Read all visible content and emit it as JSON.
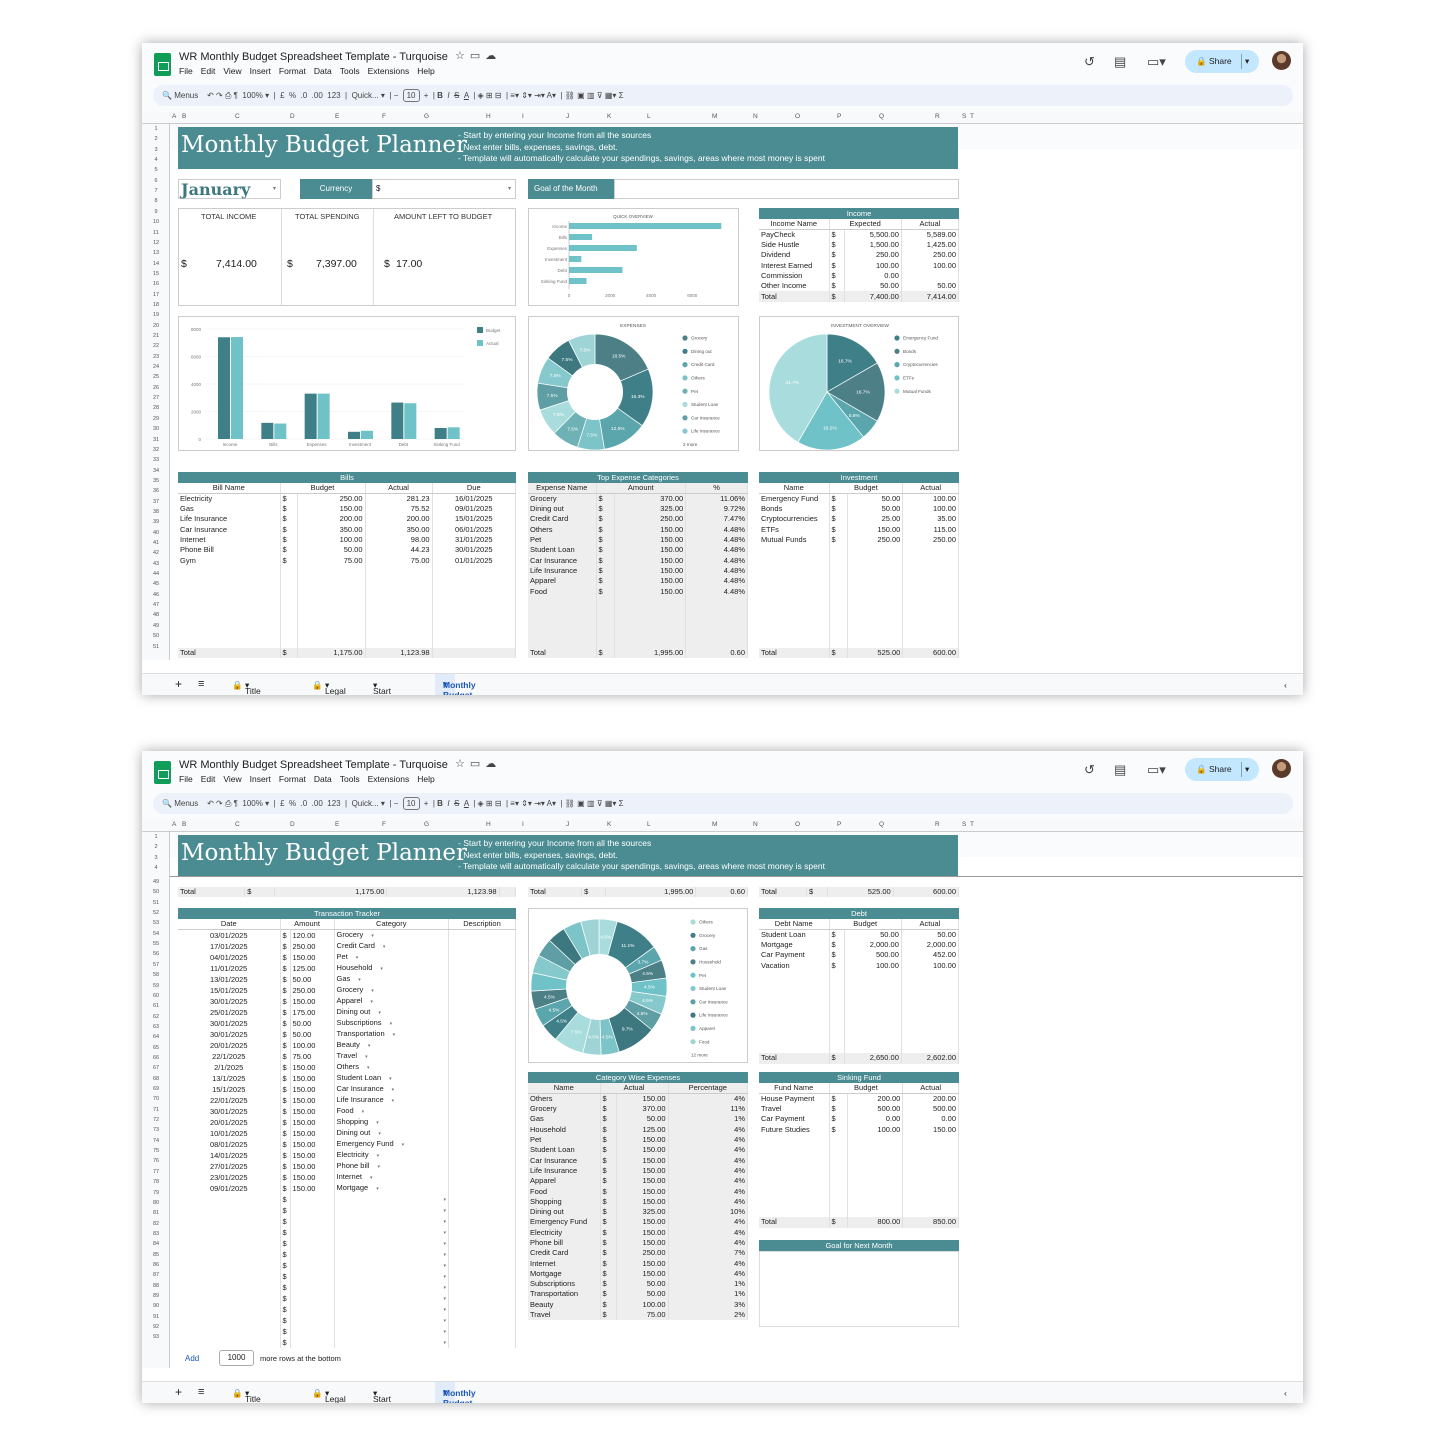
{
  "app": {
    "title": "WR Monthly Budget Spreadsheet Template - Turquoise",
    "menu": [
      "File",
      "Edit",
      "View",
      "Insert",
      "Format",
      "Data",
      "Tools",
      "Extensions",
      "Help"
    ],
    "share": "Share",
    "toolbar": {
      "search": "Menus",
      "zoom": "100%",
      "cur": "£",
      "pct": "%",
      "dec1": ".0",
      "dec2": ".00",
      "num": "123",
      "font": "Quick...",
      "size": "10"
    }
  },
  "colheaders": [
    "A",
    "B",
    "C",
    "D",
    "E",
    "F",
    "G",
    "H",
    "I",
    "J",
    "K",
    "L",
    "M",
    "N",
    "O",
    "P",
    "Q",
    "R",
    "S",
    "T"
  ],
  "tabs": [
    "Title Page",
    "Legal",
    "Start Here",
    "Monthly Budget"
  ],
  "header": {
    "title": "Monthly Budget Planner",
    "notes": [
      "- Start by entering your Income from all the sources",
      "- Next enter bills, expenses, savings, debt.",
      "- Template will automatically calculate your spendings, savings, areas where most money is spent"
    ]
  },
  "month": "January",
  "currency_label": "Currency",
  "currency_value": "$",
  "goal_label": "Goal of the Month",
  "summary": {
    "labels": [
      "TOTAL INCOME",
      "TOTAL SPENDING",
      "AMOUNT LEFT TO BUDGET"
    ],
    "cur": [
      "$",
      "$",
      "$"
    ],
    "values": [
      "7,414.00",
      "7,397.00",
      "17.00"
    ]
  },
  "income": {
    "title": "Income",
    "cols": [
      "Income Name",
      "Expected",
      "Actual"
    ],
    "rows": [
      [
        "PayCheck",
        "$",
        "5,500.00",
        "5,589.00"
      ],
      [
        "Side Hustle",
        "$",
        "1,500.00",
        "1,425.00"
      ],
      [
        "Dividend",
        "$",
        "250.00",
        "250.00"
      ],
      [
        "Interest Earned",
        "$",
        "100.00",
        "100.00"
      ],
      [
        "Commission",
        "$",
        "0.00",
        ""
      ],
      [
        "Other Income",
        "$",
        "50.00",
        "50.00"
      ],
      [
        "Total",
        "$",
        "7,400.00",
        "7,414.00"
      ]
    ]
  },
  "quick": {
    "title": "QUICK OVERVIEW",
    "chart_data": {
      "type": "bar",
      "categories": [
        "Income",
        "Bills",
        "Expenses",
        "Investment",
        "Debt",
        "Sinking Fund"
      ],
      "values": [
        7414,
        1124,
        3300,
        600,
        2602,
        850
      ],
      "xticks": [
        "0",
        "2000",
        "4000",
        "6000"
      ],
      "xlim": [
        0,
        7400
      ]
    }
  },
  "compare": {
    "chart_data": {
      "type": "bar",
      "categories": [
        "Income",
        "Bills",
        "Expenses",
        "Investment",
        "Debt",
        "Sinking Fund"
      ],
      "series": [
        {
          "name": "Budget",
          "values": [
            7400,
            1175,
            3300,
            525,
            2650,
            800
          ]
        },
        {
          "name": "Actual",
          "values": [
            7414,
            1124,
            3300,
            600,
            2602,
            850
          ]
        }
      ],
      "yticks": [
        "0",
        "2000",
        "4000",
        "6000",
        "8000"
      ],
      "ylim": [
        0,
        8000
      ],
      "legend": "top-right"
    }
  },
  "expenses_pie": {
    "title": "EXPENSES",
    "chart_data": {
      "type": "pie",
      "labels": [
        "Grocery",
        "Dining out",
        "Credit Card",
        "Others",
        "Pet",
        "Student Loan",
        "Car Insurance",
        "Life Insurance"
      ],
      "values": [
        18.5,
        16.3,
        12.5,
        7.5,
        7.5,
        7.5,
        7.5,
        7.5,
        7.5,
        7.5
      ],
      "slice_labels": [
        "18.5%",
        "16.3%",
        "12.5%",
        "7.5%",
        "7.5%",
        "7.5%",
        "7.5%",
        "7.5%",
        "7.5%",
        "7.5%"
      ],
      "more": "2 more"
    }
  },
  "investment_pie": {
    "title": "INVESTMENT OVERVIEW",
    "chart_data": {
      "type": "pie",
      "labels": [
        "Emergency Fund",
        "Bonds",
        "Cryptocurrencies",
        "ETFs",
        "Mutual Funds"
      ],
      "values": [
        16.7,
        16.7,
        5.8,
        19.2,
        41.7
      ],
      "slice_labels": [
        "16.7%",
        "16.7%",
        "5.8%",
        "19.2%",
        "41.7%"
      ]
    }
  },
  "bills": {
    "title": "Bills",
    "cols": [
      "Bill Name",
      "Budget",
      "Actual",
      "Due"
    ],
    "rows": [
      [
        "Electricity",
        "$",
        "250.00",
        "281.23",
        "16/01/2025"
      ],
      [
        "Gas",
        "$",
        "150.00",
        "75.52",
        "09/01/2025"
      ],
      [
        "Life Insurance",
        "$",
        "200.00",
        "200.00",
        "15/01/2025"
      ],
      [
        "Car Insurance",
        "$",
        "350.00",
        "350.00",
        "06/01/2025"
      ],
      [
        "Internet",
        "$",
        "100.00",
        "98.00",
        "31/01/2025"
      ],
      [
        "Phone Bill",
        "$",
        "50.00",
        "44.23",
        "30/01/2025"
      ],
      [
        "Gym",
        "$",
        "75.00",
        "75.00",
        "01/01/2025"
      ]
    ],
    "total": [
      "Total",
      "$",
      "1,175.00",
      "1,123.98",
      ""
    ]
  },
  "top_expenses": {
    "title": "Top Expense Categories",
    "cols": [
      "Expense Name",
      "Amount",
      "%"
    ],
    "rows": [
      [
        "Grocery",
        "$",
        "370.00",
        "11.06%"
      ],
      [
        "Dining out",
        "$",
        "325.00",
        "9.72%"
      ],
      [
        "Credit Card",
        "$",
        "250.00",
        "7.47%"
      ],
      [
        "Others",
        "$",
        "150.00",
        "4.48%"
      ],
      [
        "Pet",
        "$",
        "150.00",
        "4.48%"
      ],
      [
        "Student Loan",
        "$",
        "150.00",
        "4.48%"
      ],
      [
        "Car Insurance",
        "$",
        "150.00",
        "4.48%"
      ],
      [
        "Life Insurance",
        "$",
        "150.00",
        "4.48%"
      ],
      [
        "Apparel",
        "$",
        "150.00",
        "4.48%"
      ],
      [
        "Food",
        "$",
        "150.00",
        "4.48%"
      ]
    ],
    "total": [
      "Total",
      "$",
      "1,995.00",
      "0.60"
    ]
  },
  "investment": {
    "title": "Investment",
    "cols": [
      "Name",
      "Budget",
      "Actual"
    ],
    "rows": [
      [
        "Emergency Fund",
        "$",
        "50.00",
        "100.00"
      ],
      [
        "Bonds",
        "$",
        "50.00",
        "100.00"
      ],
      [
        "Cryptocurrencies",
        "$",
        "25.00",
        "35.00"
      ],
      [
        "ETFs",
        "$",
        "150.00",
        "115.00"
      ],
      [
        "Mutual Funds",
        "$",
        "250.00",
        "250.00"
      ]
    ],
    "total": [
      "Total",
      "$",
      "525.00",
      "600.00"
    ]
  },
  "tracker": {
    "title": "Transaction Tracker",
    "cols": [
      "Date",
      "Amount",
      "Category",
      "Description"
    ],
    "rows": [
      [
        "03/01/2025",
        "120.00",
        "Grocery"
      ],
      [
        "17/01/2025",
        "250.00",
        "Credit Card"
      ],
      [
        "04/01/2025",
        "150.00",
        "Pet"
      ],
      [
        "11/01/2025",
        "125.00",
        "Household"
      ],
      [
        "13/01/2025",
        "50.00",
        "Gas"
      ],
      [
        "15/01/2025",
        "250.00",
        "Grocery"
      ],
      [
        "30/01/2025",
        "150.00",
        "Apparel"
      ],
      [
        "25/01/2025",
        "175.00",
        "Dining out"
      ],
      [
        "30/01/2025",
        "50.00",
        "Subscriptions"
      ],
      [
        "30/01/2025",
        "50.00",
        "Transportation"
      ],
      [
        "20/01/2025",
        "100.00",
        "Beauty"
      ],
      [
        "22/1/2025",
        "75.00",
        "Travel"
      ],
      [
        "2/1/2025",
        "150.00",
        "Others"
      ],
      [
        "13/1/2025",
        "150.00",
        "Student Loan"
      ],
      [
        "15/1/2025",
        "150.00",
        "Car Insurance"
      ],
      [
        "22/01/2025",
        "150.00",
        "Life Insurance"
      ],
      [
        "30/01/2025",
        "150.00",
        "Food"
      ],
      [
        "20/01/2025",
        "150.00",
        "Shopping"
      ],
      [
        "10/01/2025",
        "150.00",
        "Dining out"
      ],
      [
        "08/01/2025",
        "150.00",
        "Emergency Fund"
      ],
      [
        "14/01/2025",
        "150.00",
        "Electricity"
      ],
      [
        "27/01/2025",
        "150.00",
        "Phone bill"
      ],
      [
        "23/01/2025",
        "150.00",
        "Internet"
      ],
      [
        "09/01/2025",
        "150.00",
        "Mortgage"
      ]
    ],
    "empty_rows": 14
  },
  "cat_pie": {
    "chart_data": {
      "type": "pie",
      "labels": [
        "Others",
        "Grocery",
        "Gas",
        "Household",
        "Pet",
        "Student Loan",
        "Car Insurance",
        "Life Insurance",
        "Apparel",
        "Food"
      ],
      "values": [
        4.5,
        11.1,
        3.7,
        4.5,
        4.5,
        4.5,
        4.5,
        9.7,
        4.5,
        4.5,
        7.5,
        4.5,
        4.5,
        4.5,
        4.5,
        4.5,
        4.5,
        4.5,
        4.5,
        4.5
      ],
      "slice_labels": [
        "4.5%",
        "11.1%",
        "3.7%",
        "4.5%",
        "4.5%",
        "4.5%",
        "4.5%",
        "9.7%",
        "4.5%",
        "4.5%",
        "7.5%",
        "4.5%",
        "4.5%",
        "4.5%"
      ],
      "more": "12 more"
    }
  },
  "category_wise": {
    "title": "Category Wise Expenses",
    "cols": [
      "Name",
      "Actual",
      "Percentage"
    ],
    "rows": [
      [
        "Others",
        "$",
        "150.00",
        "4%"
      ],
      [
        "Grocery",
        "$",
        "370.00",
        "11%"
      ],
      [
        "Gas",
        "$",
        "50.00",
        "1%"
      ],
      [
        "Household",
        "$",
        "125.00",
        "4%"
      ],
      [
        "Pet",
        "$",
        "150.00",
        "4%"
      ],
      [
        "Student Loan",
        "$",
        "150.00",
        "4%"
      ],
      [
        "Car Insurance",
        "$",
        "150.00",
        "4%"
      ],
      [
        "Life Insurance",
        "$",
        "150.00",
        "4%"
      ],
      [
        "Apparel",
        "$",
        "150.00",
        "4%"
      ],
      [
        "Food",
        "$",
        "150.00",
        "4%"
      ],
      [
        "Shopping",
        "$",
        "150.00",
        "4%"
      ],
      [
        "Dining out",
        "$",
        "325.00",
        "10%"
      ],
      [
        "Emergency Fund",
        "$",
        "150.00",
        "4%"
      ],
      [
        "Electricity",
        "$",
        "150.00",
        "4%"
      ],
      [
        "Phone bill",
        "$",
        "150.00",
        "4%"
      ],
      [
        "Credit Card",
        "$",
        "250.00",
        "7%"
      ],
      [
        "Internet",
        "$",
        "150.00",
        "4%"
      ],
      [
        "Mortgage",
        "$",
        "150.00",
        "4%"
      ],
      [
        "Subscriptions",
        "$",
        "50.00",
        "1%"
      ],
      [
        "Transportation",
        "$",
        "50.00",
        "1%"
      ],
      [
        "Beauty",
        "$",
        "100.00",
        "3%"
      ],
      [
        "Travel",
        "$",
        "75.00",
        "2%"
      ]
    ]
  },
  "debt": {
    "title": "Debt",
    "cols": [
      "Debt Name",
      "Budget",
      "Actual"
    ],
    "rows": [
      [
        "Student Loan",
        "$",
        "50.00",
        "50.00"
      ],
      [
        "Mortgage",
        "$",
        "2,000.00",
        "2,000.00"
      ],
      [
        "Car Payment",
        "$",
        "500.00",
        "452.00"
      ],
      [
        "Vacation",
        "$",
        "100.00",
        "100.00"
      ]
    ],
    "total": [
      "Total",
      "$",
      "2,650.00",
      "2,602.00"
    ]
  },
  "sinking": {
    "title": "Sinking Fund",
    "cols": [
      "Fund Name",
      "Budget",
      "Actual"
    ],
    "rows": [
      [
        "House Payment",
        "$",
        "200.00",
        "200.00"
      ],
      [
        "Travel",
        "$",
        "500.00",
        "500.00"
      ],
      [
        "Car Payment",
        "$",
        "0.00",
        "0.00"
      ],
      [
        "Future Studies",
        "$",
        "100.00",
        "150.00"
      ]
    ],
    "total": [
      "Total",
      "$",
      "800.00",
      "850.00"
    ]
  },
  "goal_next": "Goal for Next Month",
  "addrows": {
    "add": "Add",
    "count": "1000",
    "suffix": "more rows at the bottom"
  },
  "colors": {
    "teal": "#4a8c92",
    "dark": "#3d7880",
    "light": "#6fc2c7",
    "pale": "#a9dcdc",
    "mid": "#5aa6ac"
  }
}
